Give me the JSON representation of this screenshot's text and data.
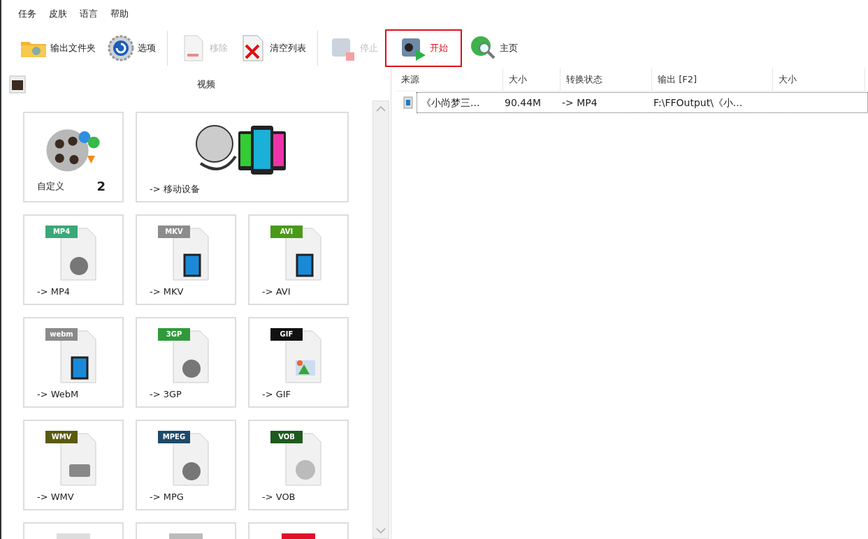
{
  "menu": [
    "任务",
    "皮肤",
    "语言",
    "帮助"
  ],
  "toolbar": [
    {
      "kind": "folder",
      "label": "输出文件夹",
      "disabled": false,
      "highlighted": false
    },
    {
      "kind": "gear",
      "label": "选项",
      "disabled": false,
      "highlighted": false
    },
    {
      "kind": "separator"
    },
    {
      "kind": "remove",
      "label": "移除",
      "disabled": true,
      "highlighted": false
    },
    {
      "kind": "clear",
      "label": "清空列表",
      "disabled": false,
      "highlighted": false
    },
    {
      "kind": "separator"
    },
    {
      "kind": "stop",
      "label": "停止",
      "disabled": true,
      "highlighted": false
    },
    {
      "kind": "start",
      "label": "开始",
      "disabled": false,
      "highlighted": true
    },
    {
      "kind": "home",
      "label": "主页",
      "disabled": false,
      "highlighted": false
    }
  ],
  "panel": {
    "title": "视频",
    "tiles": [
      {
        "kind": "custom",
        "label": "自定义",
        "count": "2"
      },
      {
        "kind": "devices",
        "label": "-> 移动设备"
      },
      {
        "kind": "reel",
        "label": "-> MP4",
        "badge": "MP4",
        "color": "#3aa878"
      },
      {
        "kind": "film",
        "label": "-> MKV",
        "badge": "MKV",
        "color": "#8c8c8c"
      },
      {
        "kind": "film",
        "label": "-> AVI",
        "badge": "AVI",
        "color": "#4a9a1a"
      },
      {
        "kind": "film",
        "label": "-> WebM",
        "badge": "webm",
        "color": "#8a8a8a"
      },
      {
        "kind": "reel",
        "label": "-> 3GP",
        "badge": "3GP",
        "color": "#2f9a3a"
      },
      {
        "kind": "image",
        "label": "-> GIF",
        "badge": "GIF",
        "color": "#111111"
      },
      {
        "kind": "camera",
        "label": "-> WMV",
        "badge": "WMV",
        "color": "#5a5a10"
      },
      {
        "kind": "reel",
        "label": "-> MPG",
        "badge": "MPEG",
        "color": "#1d4a6a"
      },
      {
        "kind": "disc",
        "label": "-> VOB",
        "badge": "VOB",
        "color": "#1e5a1e"
      },
      {
        "kind": "partial",
        "color": "#dddddd"
      },
      {
        "kind": "partial",
        "color": "#bbbbbb"
      },
      {
        "kind": "partial",
        "color": "#e0102a"
      }
    ]
  },
  "table": {
    "columns": [
      "来源",
      "大小",
      "转换状态",
      "输出 [F2]",
      "大小"
    ],
    "rows": [
      {
        "cells": [
          "《小尚梦三...",
          "90.44M",
          "-> MP4",
          "F:\\FFOutput\\《小..."
        ],
        "selected": true
      }
    ]
  }
}
